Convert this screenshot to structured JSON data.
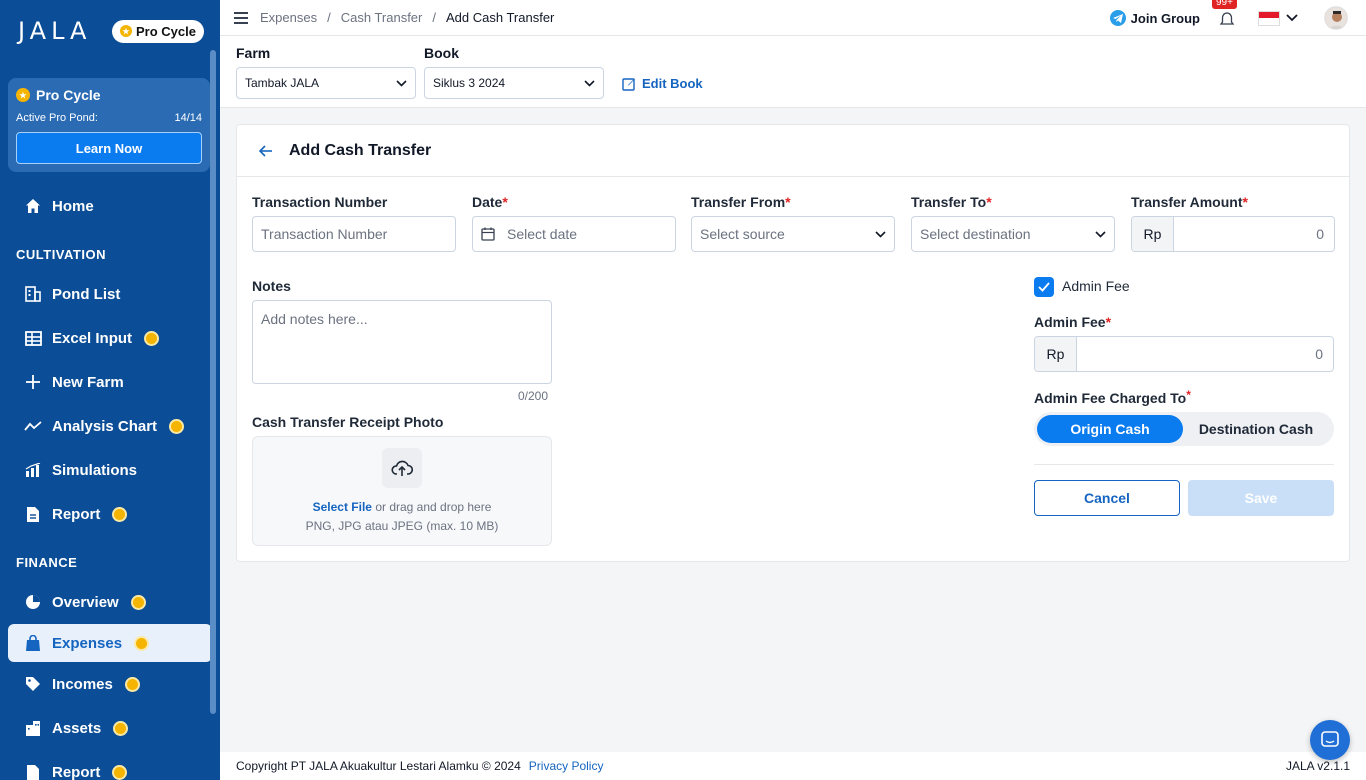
{
  "sidebar": {
    "logo": "JALA",
    "pro_pill": "Pro Cycle",
    "pro_card": {
      "title": "Pro Cycle",
      "active_label": "Active Pro Pond:",
      "active_value": "14/14",
      "button": "Learn Now"
    },
    "home": "Home",
    "cultivation_label": "CULTIVATION",
    "cultivation": [
      {
        "label": "Pond List",
        "icon": "pond-list-icon",
        "pro": false
      },
      {
        "label": "Excel Input",
        "icon": "table-icon",
        "pro": true
      },
      {
        "label": "New Farm",
        "icon": "plus-icon",
        "pro": false
      },
      {
        "label": "Analysis Chart",
        "icon": "chart-line-icon",
        "pro": true
      },
      {
        "label": "Simulations",
        "icon": "simulation-icon",
        "pro": false
      },
      {
        "label": "Report",
        "icon": "report-icon",
        "pro": true
      }
    ],
    "finance_label": "FINANCE",
    "finance": [
      {
        "label": "Overview",
        "icon": "pie-icon",
        "pro": true
      },
      {
        "label": "Expenses",
        "icon": "bag-icon",
        "pro": true,
        "active": true
      },
      {
        "label": "Incomes",
        "icon": "tag-icon",
        "pro": true
      },
      {
        "label": "Assets",
        "icon": "building-icon",
        "pro": true
      },
      {
        "label": "Report",
        "icon": "report-icon",
        "pro": true
      }
    ]
  },
  "topbar": {
    "breadcrumb": [
      "Expenses",
      "Cash Transfer",
      "Add Cash Transfer"
    ],
    "join_group": "Join Group",
    "notif_count": "99+"
  },
  "filters": {
    "farm_label": "Farm",
    "farm_value": "Tambak JALA",
    "book_label": "Book",
    "book_value": "Siklus 3 2024",
    "edit_book": "Edit Book"
  },
  "form": {
    "title": "Add Cash Transfer",
    "transaction_number": {
      "label": "Transaction Number",
      "placeholder": "Transaction Number"
    },
    "date": {
      "label": "Date",
      "placeholder": "Select date"
    },
    "transfer_from": {
      "label": "Transfer From",
      "placeholder": "Select source"
    },
    "transfer_to": {
      "label": "Transfer To",
      "placeholder": "Select destination"
    },
    "transfer_amount": {
      "label": "Transfer Amount",
      "prefix": "Rp",
      "value": "0"
    },
    "notes": {
      "label": "Notes",
      "placeholder": "Add notes here...",
      "counter": "0/200"
    },
    "receipt": {
      "label": "Cash Transfer Receipt Photo",
      "select_file": "Select File",
      "drag_text": "or drag and drop here",
      "formats": "PNG, JPG atau JPEG (max. 10 MB)"
    },
    "admin_fee_checkbox": "Admin Fee",
    "admin_fee": {
      "label": "Admin Fee",
      "prefix": "Rp",
      "value": "0"
    },
    "charged_to": {
      "label": "Admin Fee Charged To",
      "options": [
        "Origin Cash",
        "Destination Cash"
      ],
      "selected": "Origin Cash"
    },
    "cancel": "Cancel",
    "save": "Save"
  },
  "footer": {
    "copyright": "Copyright PT JALA Akuakultur Lestari Alamku © 2024",
    "privacy": "Privacy Policy",
    "version": "JALA v2.1.1"
  },
  "colors": {
    "sidebar_bg": "#0b4d96",
    "primary": "#0a7cf0",
    "pro_badge": "#f5b400",
    "required": "#e02424"
  }
}
